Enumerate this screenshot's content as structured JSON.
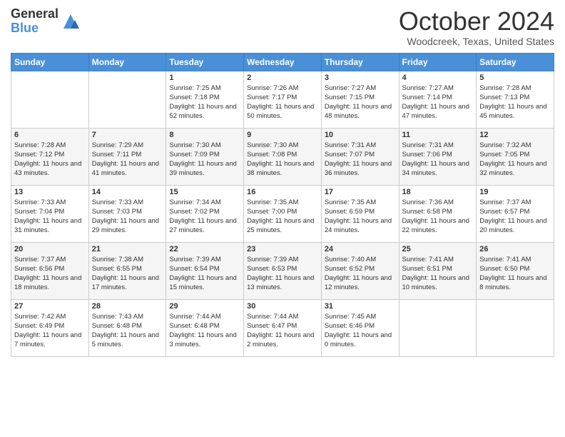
{
  "header": {
    "logo_general": "General",
    "logo_blue": "Blue",
    "month_title": "October 2024",
    "location": "Woodcreek, Texas, United States"
  },
  "days_of_week": [
    "Sunday",
    "Monday",
    "Tuesday",
    "Wednesday",
    "Thursday",
    "Friday",
    "Saturday"
  ],
  "weeks": [
    [
      {
        "day": "",
        "sunrise": "",
        "sunset": "",
        "daylight": ""
      },
      {
        "day": "",
        "sunrise": "",
        "sunset": "",
        "daylight": ""
      },
      {
        "day": "1",
        "sunrise": "Sunrise: 7:25 AM",
        "sunset": "Sunset: 7:18 PM",
        "daylight": "Daylight: 11 hours and 52 minutes."
      },
      {
        "day": "2",
        "sunrise": "Sunrise: 7:26 AM",
        "sunset": "Sunset: 7:17 PM",
        "daylight": "Daylight: 11 hours and 50 minutes."
      },
      {
        "day": "3",
        "sunrise": "Sunrise: 7:27 AM",
        "sunset": "Sunset: 7:15 PM",
        "daylight": "Daylight: 11 hours and 48 minutes."
      },
      {
        "day": "4",
        "sunrise": "Sunrise: 7:27 AM",
        "sunset": "Sunset: 7:14 PM",
        "daylight": "Daylight: 11 hours and 47 minutes."
      },
      {
        "day": "5",
        "sunrise": "Sunrise: 7:28 AM",
        "sunset": "Sunset: 7:13 PM",
        "daylight": "Daylight: 11 hours and 45 minutes."
      }
    ],
    [
      {
        "day": "6",
        "sunrise": "Sunrise: 7:28 AM",
        "sunset": "Sunset: 7:12 PM",
        "daylight": "Daylight: 11 hours and 43 minutes."
      },
      {
        "day": "7",
        "sunrise": "Sunrise: 7:29 AM",
        "sunset": "Sunset: 7:11 PM",
        "daylight": "Daylight: 11 hours and 41 minutes."
      },
      {
        "day": "8",
        "sunrise": "Sunrise: 7:30 AM",
        "sunset": "Sunset: 7:09 PM",
        "daylight": "Daylight: 11 hours and 39 minutes."
      },
      {
        "day": "9",
        "sunrise": "Sunrise: 7:30 AM",
        "sunset": "Sunset: 7:08 PM",
        "daylight": "Daylight: 11 hours and 38 minutes."
      },
      {
        "day": "10",
        "sunrise": "Sunrise: 7:31 AM",
        "sunset": "Sunset: 7:07 PM",
        "daylight": "Daylight: 11 hours and 36 minutes."
      },
      {
        "day": "11",
        "sunrise": "Sunrise: 7:31 AM",
        "sunset": "Sunset: 7:06 PM",
        "daylight": "Daylight: 11 hours and 34 minutes."
      },
      {
        "day": "12",
        "sunrise": "Sunrise: 7:32 AM",
        "sunset": "Sunset: 7:05 PM",
        "daylight": "Daylight: 11 hours and 32 minutes."
      }
    ],
    [
      {
        "day": "13",
        "sunrise": "Sunrise: 7:33 AM",
        "sunset": "Sunset: 7:04 PM",
        "daylight": "Daylight: 11 hours and 31 minutes."
      },
      {
        "day": "14",
        "sunrise": "Sunrise: 7:33 AM",
        "sunset": "Sunset: 7:03 PM",
        "daylight": "Daylight: 11 hours and 29 minutes."
      },
      {
        "day": "15",
        "sunrise": "Sunrise: 7:34 AM",
        "sunset": "Sunset: 7:02 PM",
        "daylight": "Daylight: 11 hours and 27 minutes."
      },
      {
        "day": "16",
        "sunrise": "Sunrise: 7:35 AM",
        "sunset": "Sunset: 7:00 PM",
        "daylight": "Daylight: 11 hours and 25 minutes."
      },
      {
        "day": "17",
        "sunrise": "Sunrise: 7:35 AM",
        "sunset": "Sunset: 6:59 PM",
        "daylight": "Daylight: 11 hours and 24 minutes."
      },
      {
        "day": "18",
        "sunrise": "Sunrise: 7:36 AM",
        "sunset": "Sunset: 6:58 PM",
        "daylight": "Daylight: 11 hours and 22 minutes."
      },
      {
        "day": "19",
        "sunrise": "Sunrise: 7:37 AM",
        "sunset": "Sunset: 6:57 PM",
        "daylight": "Daylight: 11 hours and 20 minutes."
      }
    ],
    [
      {
        "day": "20",
        "sunrise": "Sunrise: 7:37 AM",
        "sunset": "Sunset: 6:56 PM",
        "daylight": "Daylight: 11 hours and 18 minutes."
      },
      {
        "day": "21",
        "sunrise": "Sunrise: 7:38 AM",
        "sunset": "Sunset: 6:55 PM",
        "daylight": "Daylight: 11 hours and 17 minutes."
      },
      {
        "day": "22",
        "sunrise": "Sunrise: 7:39 AM",
        "sunset": "Sunset: 6:54 PM",
        "daylight": "Daylight: 11 hours and 15 minutes."
      },
      {
        "day": "23",
        "sunrise": "Sunrise: 7:39 AM",
        "sunset": "Sunset: 6:53 PM",
        "daylight": "Daylight: 11 hours and 13 minutes."
      },
      {
        "day": "24",
        "sunrise": "Sunrise: 7:40 AM",
        "sunset": "Sunset: 6:52 PM",
        "daylight": "Daylight: 11 hours and 12 minutes."
      },
      {
        "day": "25",
        "sunrise": "Sunrise: 7:41 AM",
        "sunset": "Sunset: 6:51 PM",
        "daylight": "Daylight: 11 hours and 10 minutes."
      },
      {
        "day": "26",
        "sunrise": "Sunrise: 7:41 AM",
        "sunset": "Sunset: 6:50 PM",
        "daylight": "Daylight: 11 hours and 8 minutes."
      }
    ],
    [
      {
        "day": "27",
        "sunrise": "Sunrise: 7:42 AM",
        "sunset": "Sunset: 6:49 PM",
        "daylight": "Daylight: 11 hours and 7 minutes."
      },
      {
        "day": "28",
        "sunrise": "Sunrise: 7:43 AM",
        "sunset": "Sunset: 6:48 PM",
        "daylight": "Daylight: 11 hours and 5 minutes."
      },
      {
        "day": "29",
        "sunrise": "Sunrise: 7:44 AM",
        "sunset": "Sunset: 6:48 PM",
        "daylight": "Daylight: 11 hours and 3 minutes."
      },
      {
        "day": "30",
        "sunrise": "Sunrise: 7:44 AM",
        "sunset": "Sunset: 6:47 PM",
        "daylight": "Daylight: 11 hours and 2 minutes."
      },
      {
        "day": "31",
        "sunrise": "Sunrise: 7:45 AM",
        "sunset": "Sunset: 6:46 PM",
        "daylight": "Daylight: 11 hours and 0 minutes."
      },
      {
        "day": "",
        "sunrise": "",
        "sunset": "",
        "daylight": ""
      },
      {
        "day": "",
        "sunrise": "",
        "sunset": "",
        "daylight": ""
      }
    ]
  ]
}
